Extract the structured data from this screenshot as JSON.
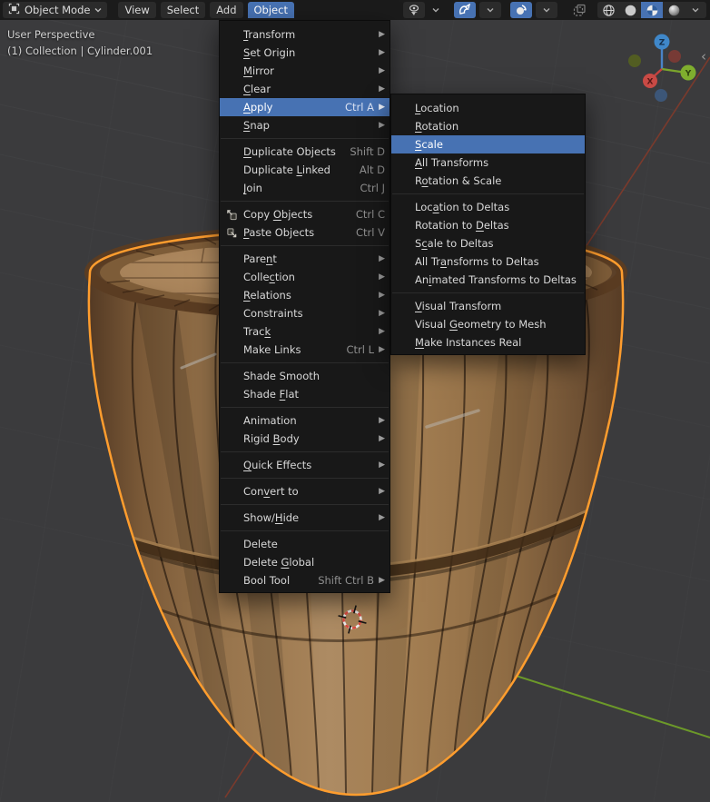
{
  "header": {
    "mode_label": "Object Mode",
    "mode_icon": "object-mode-icon",
    "menus": [
      {
        "label": "View"
      },
      {
        "label": "Select"
      },
      {
        "label": "Add"
      },
      {
        "label": "Object",
        "active": true
      }
    ],
    "right_icons": [
      "pivot-point-icon",
      "snap-magnet-icon",
      "proportional-editing-icon",
      "gizmos-icon",
      "wireframe-shading-icon",
      "solid-shading-icon",
      "material-shading-icon",
      "rendered-shading-icon"
    ]
  },
  "viewport": {
    "overlay_line1": "User Perspective",
    "overlay_line2": "(1) Collection | Cylinder.001",
    "selected_object": "Cylinder.001",
    "gizmo_axes": {
      "x": "X",
      "y": "Y",
      "z": "Z"
    },
    "collapse_glyph": "‹"
  },
  "object_menu": {
    "items": [
      {
        "label": "Transform",
        "accel": 0,
        "submenu": true
      },
      {
        "label": "Set Origin",
        "accel": 0,
        "submenu": true
      },
      {
        "label": "Mirror",
        "accel": 0,
        "submenu": true
      },
      {
        "label": "Clear",
        "accel": 0,
        "submenu": true
      },
      {
        "label": "Apply",
        "accel": 0,
        "submenu": true,
        "shortcut": "Ctrl A",
        "highlighted": true
      },
      {
        "label": "Snap",
        "accel": 0,
        "submenu": true
      },
      {
        "type": "sep"
      },
      {
        "label": "Duplicate Objects",
        "accel": 0,
        "shortcut": "Shift D"
      },
      {
        "label": "Duplicate Linked",
        "accel": 10,
        "shortcut": "Alt D"
      },
      {
        "label": "Join",
        "accel": 0,
        "shortcut": "Ctrl J"
      },
      {
        "type": "sep"
      },
      {
        "label": "Copy Objects",
        "accel": 5,
        "shortcut": "Ctrl C",
        "icon": "copy-objects-icon"
      },
      {
        "label": "Paste Objects",
        "accel": 0,
        "shortcut": "Ctrl V",
        "icon": "paste-objects-icon"
      },
      {
        "type": "sep"
      },
      {
        "label": "Parent",
        "accel": 4,
        "submenu": true
      },
      {
        "label": "Collection",
        "accel": 5,
        "submenu": true
      },
      {
        "label": "Relations",
        "accel": 0,
        "submenu": true
      },
      {
        "label": "Constraints",
        "accel": -1,
        "submenu": true
      },
      {
        "label": "Track",
        "accel": 4,
        "submenu": true
      },
      {
        "label": "Make Links",
        "accel": -1,
        "submenu": true,
        "shortcut": "Ctrl L"
      },
      {
        "type": "sep"
      },
      {
        "label": "Shade Smooth",
        "accel": -1
      },
      {
        "label": "Shade Flat",
        "accel": 6
      },
      {
        "type": "sep"
      },
      {
        "label": "Animation",
        "accel": -1,
        "submenu": true
      },
      {
        "label": "Rigid Body",
        "accel": 6,
        "submenu": true
      },
      {
        "type": "sep"
      },
      {
        "label": "Quick Effects",
        "accel": 0,
        "submenu": true
      },
      {
        "type": "sep"
      },
      {
        "label": "Convert to",
        "accel": 3,
        "submenu": true
      },
      {
        "type": "sep"
      },
      {
        "label": "Show/Hide",
        "accel": 5,
        "submenu": true
      },
      {
        "type": "sep"
      },
      {
        "label": "Delete",
        "accel": -1
      },
      {
        "label": "Delete Global",
        "accel": 7
      },
      {
        "label": "Bool Tool",
        "accel": -1,
        "submenu": true,
        "shortcut": "Shift Ctrl B"
      }
    ]
  },
  "apply_submenu": {
    "items": [
      {
        "label": "Location",
        "accel": 0
      },
      {
        "label": "Rotation",
        "accel": 0
      },
      {
        "label": "Scale",
        "accel": 0,
        "highlighted": true
      },
      {
        "label": "All Transforms",
        "accel": 0
      },
      {
        "label": "Rotation & Scale",
        "accel": 1
      },
      {
        "type": "sep"
      },
      {
        "label": "Location to Deltas",
        "accel": 3
      },
      {
        "label": "Rotation to Deltas",
        "accel": 12
      },
      {
        "label": "Scale to Deltas",
        "accel": 1
      },
      {
        "label": "All Transforms to Deltas",
        "accel": 6
      },
      {
        "label": "Animated Transforms to Deltas",
        "accel": 2
      },
      {
        "type": "sep"
      },
      {
        "label": "Visual Transform",
        "accel": 0
      },
      {
        "label": "Visual Geometry to Mesh",
        "accel": 7
      },
      {
        "label": "Make Instances Real",
        "accel": 0
      }
    ]
  },
  "colors": {
    "accent_blue": "#4772b3",
    "selection_outline": "#ff9d2e",
    "viewport_bg": "#3b3b3d",
    "header_bg": "#1b1b1b",
    "panel_bg": "#181818",
    "button_bg": "#2b2b2b",
    "menu_text": "#d8d8d8",
    "shortcut_text": "#8f8f8f",
    "grid_line": "#47484a",
    "axis_x_red": "#7e3a2c",
    "axis_y_green": "#6f9f28",
    "gizmo_x": "#c94a45",
    "gizmo_y": "#7fae2e",
    "gizmo_z": "#3f87c9",
    "wood_mid": "#a07c50",
    "wood_dark": "#5a3c22",
    "cursor_red": "#d94a3f"
  }
}
